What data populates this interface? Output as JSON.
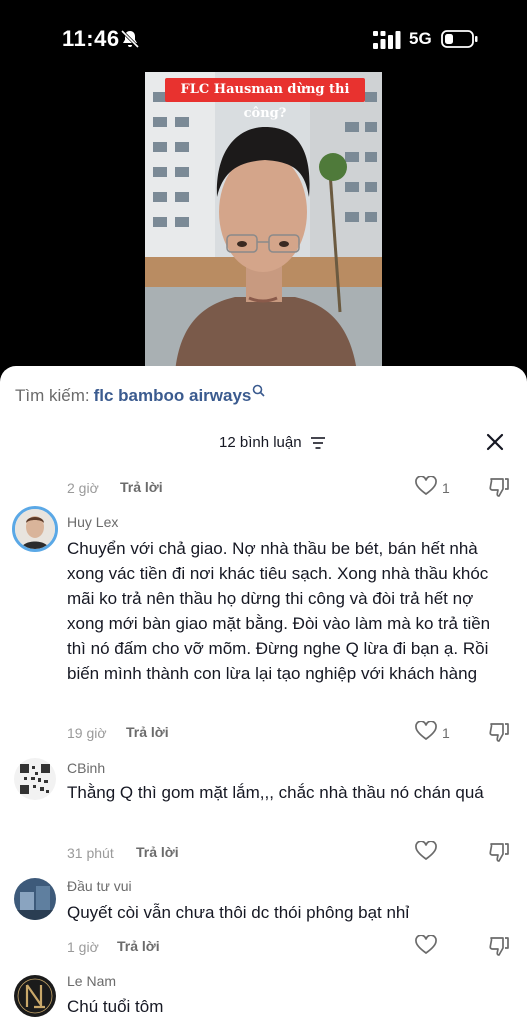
{
  "status_bar": {
    "time": "11:46",
    "network": "5G"
  },
  "video": {
    "caption": "FLC Hausman dừng thi công?"
  },
  "search": {
    "label": "Tìm kiếm:",
    "query": "flc bamboo airways"
  },
  "header": {
    "count_label": "12 bình luận"
  },
  "first_meta": {
    "time": "2 giờ",
    "reply_label": "Trả lời",
    "likes": "1"
  },
  "comments": [
    {
      "username": "Huy Lex",
      "text": "Chuyển với chả giao. Nợ nhà thầu be bét, bán hết nhà xong vác tiền đi nơi khác tiêu sạch. Xong nhà thầu khóc mãi ko trả nên thầu họ dừng thi công và đòi trả hết nợ xong mới bàn giao mặt bằng. Đòi vào làm mà ko trả tiền thì nó đấm cho vỡ mõm. Đừng nghe Q lừa đi bạn ạ. Rồi biến mình thành con lừa lại tạo nghiệp với khách hàng",
      "time": "19 giờ",
      "reply_label": "Trả lời",
      "likes": "1"
    },
    {
      "username": "CBinh",
      "text": "Thằng Q thì gom mặt lắm,,, chắc nhà thầu nó chán quá",
      "time": "31 phút",
      "reply_label": "Trả lời",
      "likes": ""
    },
    {
      "username": "Đầu tư vui",
      "text": "Quyết còi vẫn chưa thôi dc thói phông bạt nhỉ",
      "time": "1 giờ",
      "reply_label": "Trả lời",
      "likes": ""
    },
    {
      "username": "Le Nam",
      "text": "Chú tuổi tôm"
    }
  ],
  "colors": {
    "link": "#3b5b8f",
    "text": "#161823",
    "muted": "#9a9a9a"
  }
}
